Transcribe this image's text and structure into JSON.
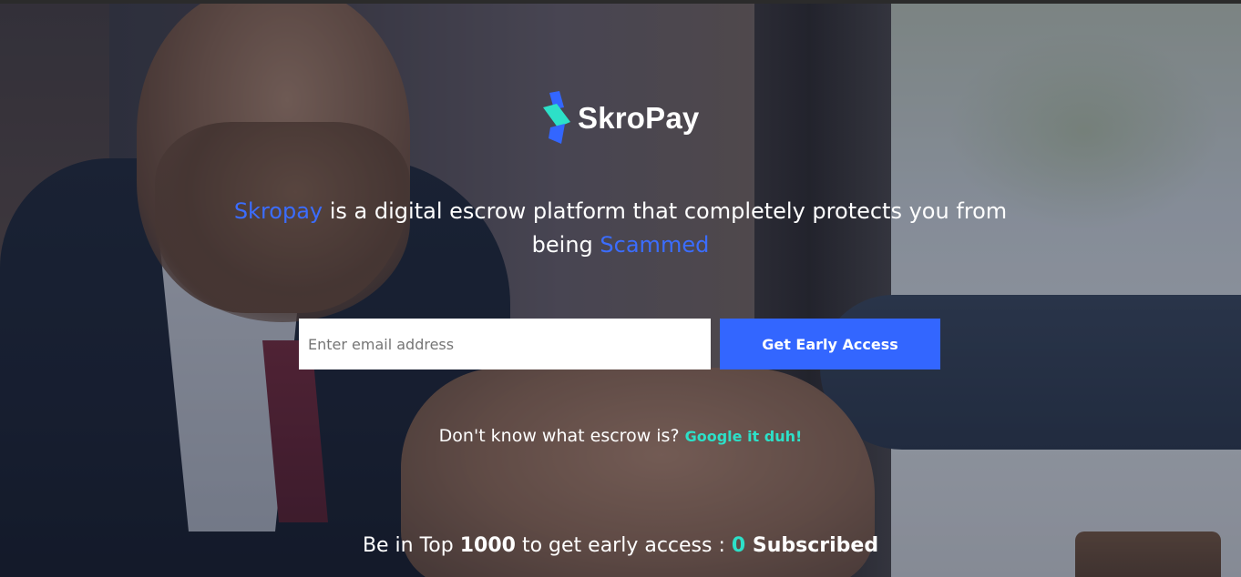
{
  "brand": {
    "name": "SkroPay",
    "logo_colors": {
      "top": "#3366ff",
      "middle": "#2de0c8",
      "bottom": "#3366ff"
    }
  },
  "hero": {
    "brand_word": "Skropay",
    "tagline_middle": " is a digital escrow platform that completely protects you from being ",
    "tagline_end_word": "Scammed",
    "accent_color": "#3b6dff"
  },
  "signup": {
    "email_placeholder": "Enter email address",
    "email_value": "",
    "button_label": "Get Early Access",
    "button_color": "#3366ff"
  },
  "escrow_hint": {
    "question": "Don't know what escrow is?",
    "link_label": "Google it duh!",
    "link_color": "#2de0c8"
  },
  "counter": {
    "prefix": "Be in Top ",
    "limit": "1000",
    "middle": " to get early access : ",
    "count": "0",
    "suffix": " Subscribed"
  },
  "background": {
    "description_icon": "handshake-photo",
    "overlay_color": "rgba(20,24,40,0.42)"
  }
}
